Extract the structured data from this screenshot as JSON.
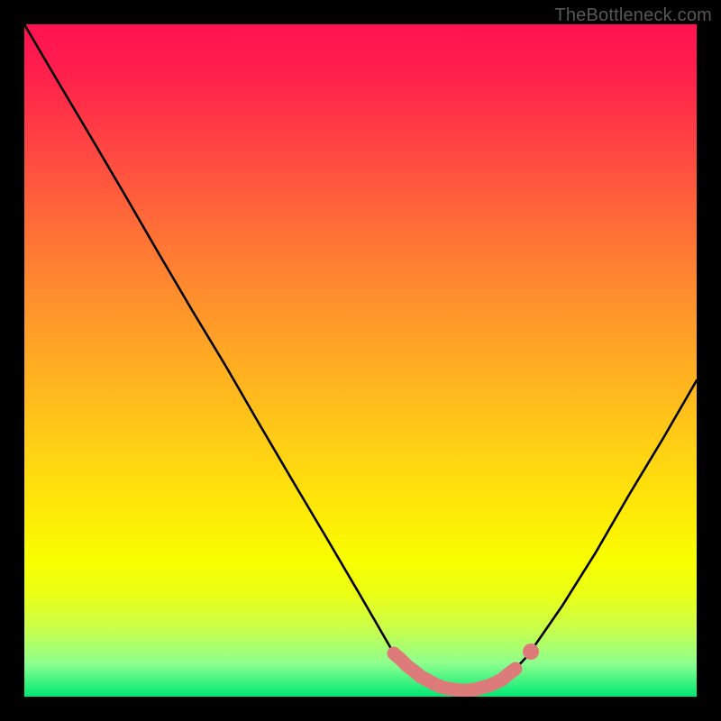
{
  "credit": "TheBottleneck.com",
  "chart_data": {
    "type": "line",
    "title": "",
    "xlabel": "",
    "ylabel": "",
    "xlim": [
      0,
      100
    ],
    "ylim": [
      0,
      100
    ],
    "series": [
      {
        "name": "curve",
        "x": [
          0,
          5,
          10,
          15,
          20,
          25,
          30,
          35,
          40,
          45,
          50,
          55,
          56,
          57,
          58,
          59,
          60,
          61,
          62,
          63,
          64,
          65,
          66,
          67,
          68,
          69,
          70,
          71,
          72,
          73,
          75,
          80,
          85,
          90,
          95,
          100
        ],
        "y": [
          100,
          91.5,
          83,
          74.5,
          66,
          57.5,
          49,
          40.5,
          32,
          23.5,
          15,
          6.5,
          5.5,
          4.5,
          3.7,
          3.0,
          2.4,
          1.9,
          1.5,
          1.2,
          1.1,
          1.0,
          1.0,
          1.1,
          1.3,
          1.6,
          2.0,
          2.6,
          3.3,
          4.1,
          6.2,
          13.5,
          21.5,
          30,
          38.5,
          47
        ]
      },
      {
        "name": "marker-band",
        "x": [
          55,
          56,
          57,
          58,
          59,
          60,
          61,
          62,
          63,
          64,
          65,
          66,
          67,
          68,
          69,
          70,
          71,
          72,
          73
        ],
        "y": [
          6.5,
          5.5,
          4.5,
          3.7,
          3.0,
          2.4,
          1.9,
          1.5,
          1.2,
          1.1,
          1.0,
          1.0,
          1.1,
          1.3,
          1.6,
          2.0,
          2.6,
          3.3,
          4.1
        ]
      }
    ],
    "colors": {
      "curve": "#000000",
      "marker": "#dd7b7b"
    }
  }
}
